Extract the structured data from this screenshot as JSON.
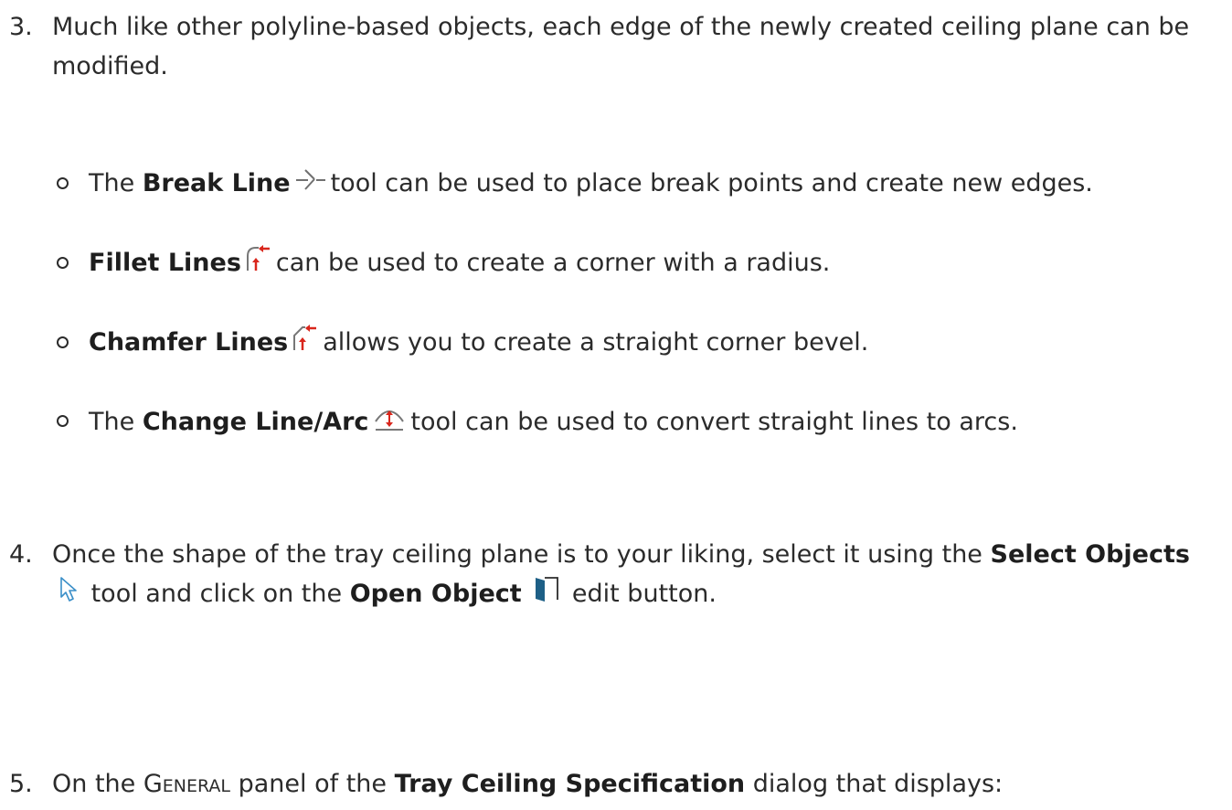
{
  "step3": {
    "number": "3.",
    "text": "Much like other polyline-based objects, each edge of the newly created ceiling plane can be modified.",
    "bullets": [
      {
        "prefix": "The",
        "bold": "Break Line",
        "icon": "break-line-icon",
        "suffix": "tool can be used to place break points and create new edges."
      },
      {
        "prefix": "",
        "bold": "Fillet Lines",
        "icon": "fillet-lines-icon",
        "suffix": "can be used to create a corner with a radius."
      },
      {
        "prefix": "",
        "bold": "Chamfer Lines",
        "icon": "chamfer-lines-icon",
        "suffix": "allows you to create a straight corner bevel."
      },
      {
        "prefix": "The",
        "bold": "Change Line/Arc",
        "icon": "change-line-arc-icon",
        "suffix": "tool can be used to convert straight lines to arcs."
      }
    ]
  },
  "step4": {
    "number": "4.",
    "text_a": "Once the shape of the tray ceiling plane is to your liking, select it using the",
    "bold_a": "Select Objects",
    "icon_a": "select-objects-icon",
    "text_b": "tool and click on the",
    "bold_b": "Open Object",
    "icon_b": "open-object-icon",
    "text_c": "edit button."
  },
  "step5": {
    "number": "5.",
    "text_a": "On the",
    "panel_name": "General",
    "text_b": "panel of the",
    "bold_a": "Tray Ceiling Specification",
    "text_c": "dialog that displays:"
  },
  "colors": {
    "text": "#2b2b2b",
    "icon_red": "#d9261c",
    "icon_blue": "#1d5f86"
  }
}
